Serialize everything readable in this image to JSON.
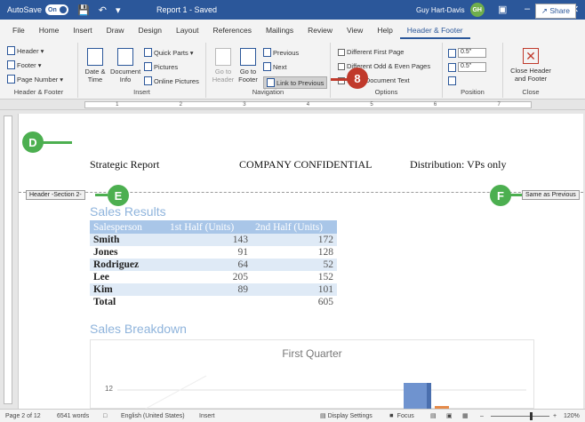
{
  "titlebar": {
    "autosave_label": "AutoSave",
    "autosave_state": "On",
    "document_title": "Report 1 - Saved",
    "user_name": "Guy Hart-Davis",
    "user_initials": "GH"
  },
  "tabs": [
    "File",
    "Home",
    "Insert",
    "Draw",
    "Design",
    "Layout",
    "References",
    "Mailings",
    "Review",
    "View",
    "Help",
    "Header & Footer"
  ],
  "active_tab": "Header & Footer",
  "share_label": "Share",
  "ribbon": {
    "hf_group": {
      "header": "Header",
      "footer": "Footer",
      "page_number": "Page Number",
      "label": "Header & Footer"
    },
    "insert_group": {
      "date_time": "Date & Time",
      "doc_info": "Document Info",
      "quick_parts": "Quick Parts",
      "pictures": "Pictures",
      "online_pictures": "Online Pictures",
      "label": "Insert"
    },
    "nav_group": {
      "go_to_header": "Go to Header",
      "go_to_footer": "Go to Footer",
      "previous": "Previous",
      "next": "Next",
      "link_to_previous": "Link to Previous",
      "label": "Navigation"
    },
    "options_group": {
      "diff_first": "Different First Page",
      "diff_odd_even": "Different Odd & Even Pages",
      "show_doc_text": "Show Document Text",
      "label": "Options"
    },
    "position_group": {
      "header_pos": "0.5\"",
      "footer_pos": "0.5\"",
      "label": "Position"
    },
    "close_group": {
      "close": "Close Header and Footer",
      "label": "Close"
    }
  },
  "callouts": {
    "step8": "8",
    "d": "D",
    "e": "E",
    "f": "F"
  },
  "document": {
    "header_left": "Strategic Report",
    "header_center": "COMPANY CONFIDENTIAL",
    "header_right": "Distribution: VPs only",
    "header_section_tag": "Header -Section 2-",
    "same_as_previous_tag": "Same as Previous",
    "section1_title": "Sales Results",
    "table": {
      "headers": [
        "Salesperson",
        "1st Half (Units)",
        "2nd Half (Units)"
      ],
      "rows": [
        [
          "Smith",
          "143",
          "172"
        ],
        [
          "Jones",
          "91",
          "128"
        ],
        [
          "Rodriguez",
          "64",
          "52"
        ],
        [
          "Lee",
          "205",
          "152"
        ],
        [
          "Kim",
          "89",
          "101"
        ],
        [
          "Total",
          "",
          "605"
        ]
      ]
    },
    "section2_title": "Sales Breakdown",
    "chart_title": "First Quarter",
    "chart_ytick": "12"
  },
  "statusbar": {
    "page": "Page 2 of 12",
    "words": "6541 words",
    "language": "English (United States)",
    "mode": "Insert",
    "display_settings": "Display Settings",
    "focus": "Focus",
    "zoom": "120%"
  }
}
